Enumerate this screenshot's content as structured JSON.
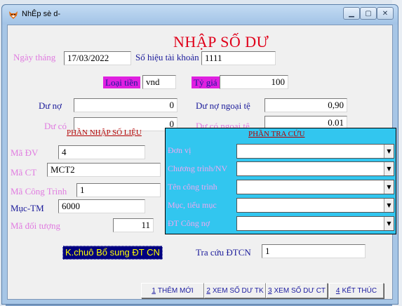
{
  "window": {
    "title": "NhÊp sè d-"
  },
  "form": {
    "heading": "NHẬP SỐ DƯ",
    "date_label": "Ngày tháng",
    "date_value": "17/03/2022",
    "account_label": "Số hiệu tài khoản",
    "account_value": "1111",
    "currency_label": "Loại tiền",
    "currency_value": "vnd",
    "rate_label": "Tỷ giá",
    "rate_value": "100",
    "debit_label": "Dư nợ",
    "debit_value": "0",
    "debit_fx_label": "Dư nợ ngoại tệ",
    "debit_fx_value": "0,90",
    "credit_label": "Dư có",
    "credit_value": "0",
    "credit_fx_label": "Dư có ngoại tệ",
    "credit_fx_value": "0.01"
  },
  "entry": {
    "title": "PHẦN NHẬP SỐ LIỆU",
    "unit_label": "Mã ĐV",
    "unit_value": "4",
    "program_label": "Mã CT",
    "program_value": "MCT2",
    "project_label": "Mã Công Trình",
    "project_value": "1",
    "item_label": "Mục-TM",
    "item_value": "6000",
    "object_label": "Mã đối tượng",
    "object_value": "11"
  },
  "lookup": {
    "title": "PHẦN TRA CỨU",
    "rows": [
      {
        "label": "Đơn vị",
        "value": ""
      },
      {
        "label": "Chương trình/NV",
        "value": ""
      },
      {
        "label": "Tên công trình",
        "value": ""
      },
      {
        "label": "Mục, tiểu mục",
        "value": ""
      },
      {
        "label": "ĐT Công nợ",
        "value": ""
      }
    ]
  },
  "extra": {
    "kchuo_label": "K.chuô Bổ sung ĐT CN",
    "lookup_dtcn_label": "Tra cứu ĐTCN",
    "lookup_dtcn_value": "1"
  },
  "buttons": [
    {
      "key": "1",
      "label": "THÊM MỚI"
    },
    {
      "key": "2",
      "label": "XEM SỐ DƯ TK"
    },
    {
      "key": "3",
      "label": "XEM SỐ DƯ CT"
    },
    {
      "key": "4",
      "label": "KẾT THÚC"
    }
  ],
  "colors": {
    "heading": "#e0001a",
    "lookup_panel": "#32c6ef",
    "magenta_label": "#e020e0",
    "button_text": "#1a1aa0"
  }
}
